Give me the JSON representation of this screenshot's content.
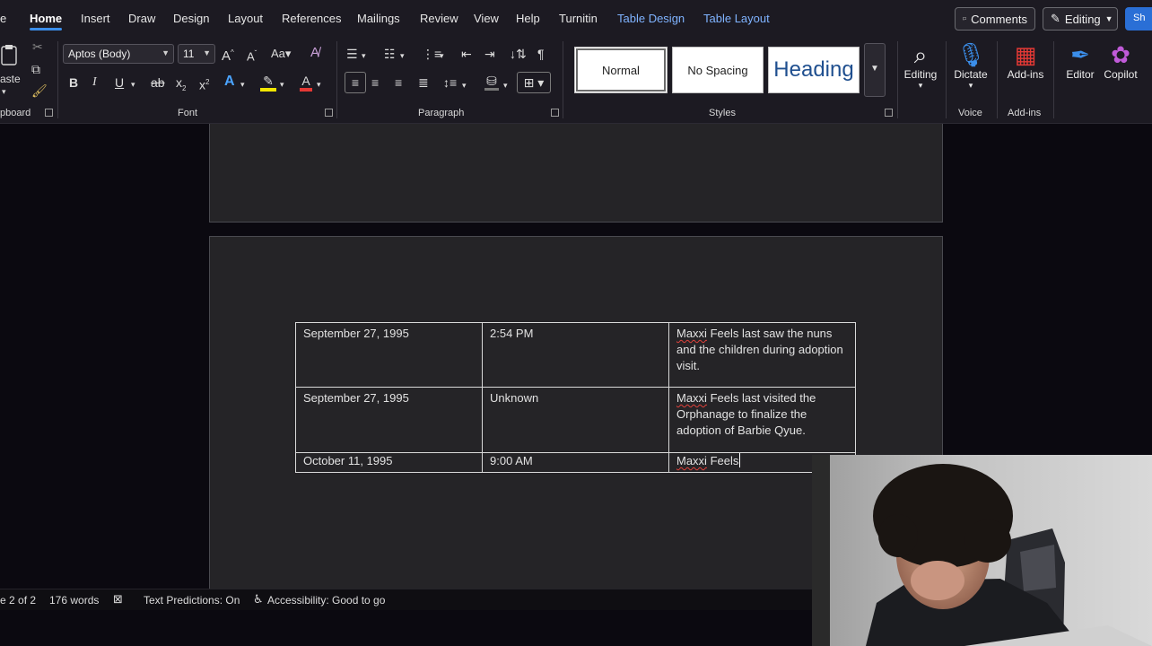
{
  "tabs": [
    "e",
    "Home",
    "Insert",
    "Draw",
    "Design",
    "Layout",
    "References",
    "Mailings",
    "Review",
    "View",
    "Help",
    "Turnitin",
    "Table Design",
    "Table Layout"
  ],
  "header_buttons": {
    "comments": "Comments",
    "editing": "Editing",
    "share": "Sh"
  },
  "ribbon": {
    "clipboard": {
      "paste_label": "aste",
      "group": "pboard"
    },
    "font": {
      "name": "Aptos (Body)",
      "size": "11",
      "group": "Font"
    },
    "paragraph": {
      "group": "Paragraph"
    },
    "styles": {
      "items": [
        "Normal",
        "No Spacing",
        "Heading"
      ],
      "group": "Styles"
    },
    "editing": {
      "label": "Editing"
    },
    "voice": {
      "button": "Dictate",
      "group": "Voice"
    },
    "addins": {
      "button": "Add-ins",
      "group": "Add-ins"
    },
    "editor": "Editor",
    "copilot": "Copilot"
  },
  "table": {
    "rows": [
      {
        "date": "September 27, 1995",
        "time": "2:54 PM",
        "desc_name": "Maxxi",
        "desc_rest": " Feels last saw the nuns and the children during adoption visit."
      },
      {
        "date": "September 27, 1995",
        "time": "Unknown",
        "desc_name": "Maxxi",
        "desc_rest": " Feels last visited the Orphanage to finalize the adoption of Barbie Qyue."
      },
      {
        "date": "October 11, 1995",
        "time": "9:00 AM",
        "desc_name": "Maxxi",
        "desc_rest": " Feels"
      }
    ]
  },
  "status": {
    "page": "e 2 of 2",
    "words": "176 words",
    "predictions": "Text Predictions: On",
    "accessibility": "Accessibility: Good to go"
  },
  "colors": {
    "accent": "#3b8eea",
    "context_tab": "#7fb3ff",
    "page_bg": "#252427",
    "ribbon_bg": "#1c1a22"
  }
}
